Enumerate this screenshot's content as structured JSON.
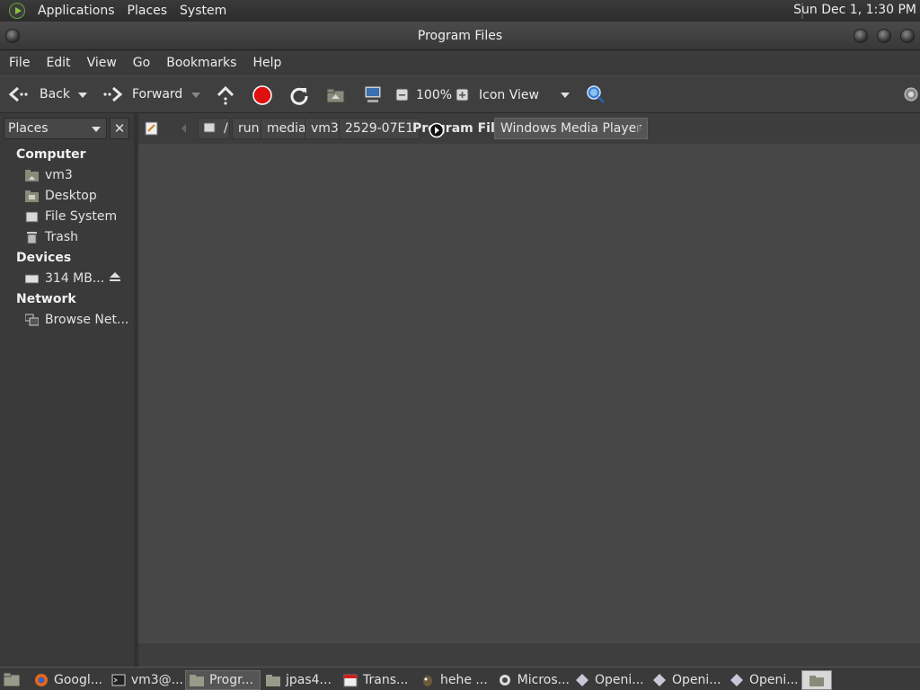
{
  "top_panel": {
    "menus": [
      "Applications",
      "Places",
      "System"
    ],
    "clock": "Sun Dec  1,  1:30 PM"
  },
  "window": {
    "title": "Program Files"
  },
  "menubar": [
    "File",
    "Edit",
    "View",
    "Go",
    "Bookmarks",
    "Help"
  ],
  "toolbar": {
    "back_label": "Back",
    "forward_label": "Forward",
    "zoom_level": "100%",
    "view_mode": "Icon View"
  },
  "sidebar": {
    "selector_label": "Places",
    "close_label": "✕",
    "sections": [
      {
        "title": "Computer",
        "items": [
          "vm3",
          "Desktop",
          "File System",
          "Trash"
        ]
      },
      {
        "title": "Devices",
        "items": [
          "314 MB..."
        ]
      },
      {
        "title": "Network",
        "items": [
          "Browse Net..."
        ]
      }
    ]
  },
  "pathbar": {
    "segments": [
      "/",
      "run",
      "media",
      "vm3",
      "2529-07E1",
      "Program Files",
      "Windows Media Player"
    ],
    "current": "Program Files",
    "next": "Windows Media Player"
  },
  "taskbar": {
    "tasks": [
      "Googl...",
      "vm3@...",
      "Progr...",
      "jpas4...",
      "Trans...",
      "hehe ...",
      "Micros...",
      "Openi...",
      "Openi...",
      "Openi..."
    ]
  },
  "colors": {
    "background": "#474747",
    "panel": "#3a3a3a",
    "stop_red": "#e01010",
    "search_blue": "#3a7fd0"
  }
}
